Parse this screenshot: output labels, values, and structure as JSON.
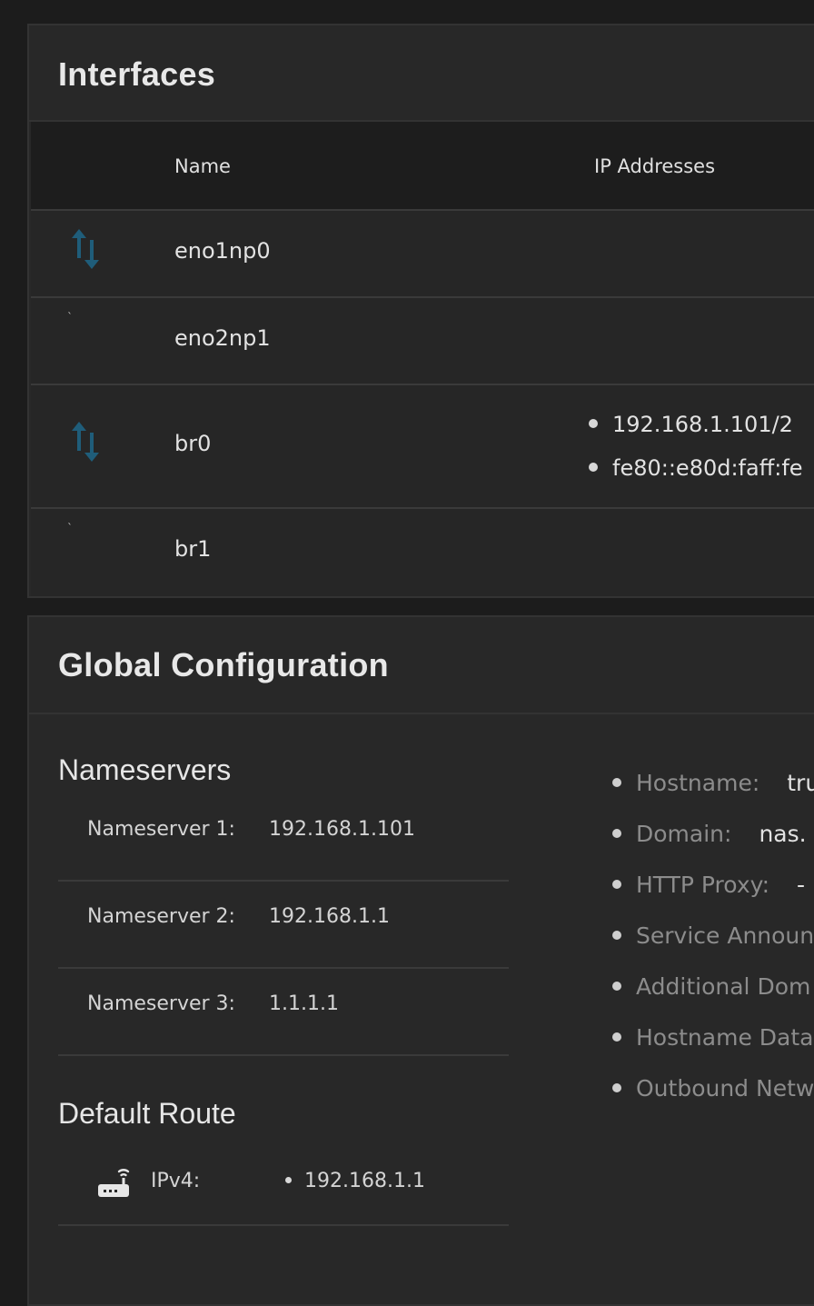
{
  "interfaces": {
    "title": "Interfaces",
    "columns": {
      "name": "Name",
      "ip_addresses": "IP Addresses"
    },
    "rows": [
      {
        "name": "eno1np0",
        "state_icon": "link-up-arrows-icon",
        "ips": []
      },
      {
        "name": "eno2np1",
        "state_icon": "link-down-icon",
        "tick": "`",
        "ips": []
      },
      {
        "name": "br0",
        "state_icon": "link-up-arrows-icon",
        "ips": [
          "192.168.1.101/2",
          "fe80::e80d:faff:fe"
        ]
      },
      {
        "name": "br1",
        "state_icon": "link-down-icon",
        "tick": "`",
        "ips": []
      }
    ]
  },
  "global": {
    "title": "Global Configuration",
    "nameservers": {
      "title": "Nameservers",
      "items": [
        {
          "label": "Nameserver 1:",
          "value": "192.168.1.101"
        },
        {
          "label": "Nameserver 2:",
          "value": "192.168.1.1"
        },
        {
          "label": "Nameserver 3:",
          "value": "1.1.1.1"
        }
      ]
    },
    "default_route": {
      "title": "Default Route",
      "icon": "router-icon",
      "label": "IPv4:",
      "value": "192.168.1.1"
    },
    "info": [
      {
        "label": "Hostname:",
        "value": "tru"
      },
      {
        "label": "Domain:",
        "value": "nas."
      },
      {
        "label": "HTTP Proxy:",
        "value": "-"
      },
      {
        "label": "Service Announ",
        "value": ""
      },
      {
        "label": "Additional Dom",
        "value": ""
      },
      {
        "label": "Hostname Data",
        "value": ""
      },
      {
        "label": "Outbound Netw",
        "value": ""
      }
    ]
  },
  "colors": {
    "background": "#1c1c1c",
    "card": "#282828",
    "table_header": "#1d1d1d",
    "link_up_icon": "#1f5d7a",
    "muted_label": "#8c8c8c"
  }
}
